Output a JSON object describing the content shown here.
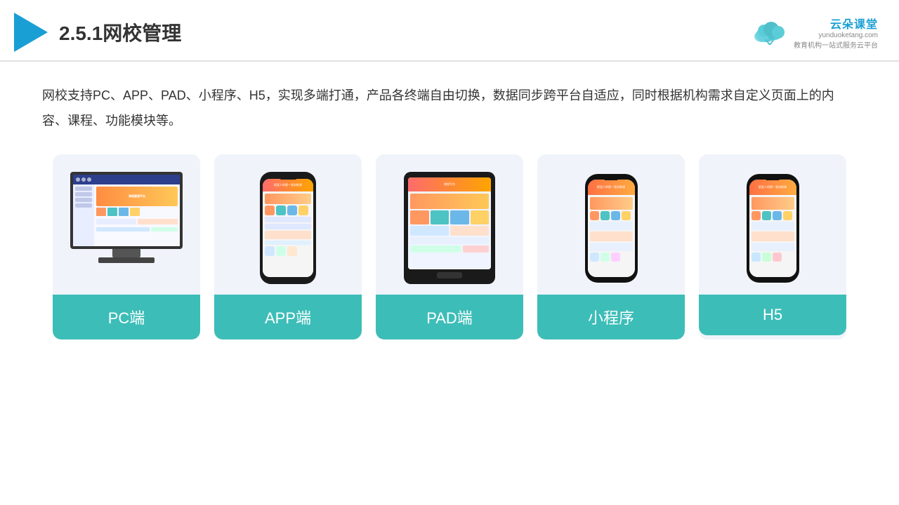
{
  "header": {
    "title_prefix": "2.5.1",
    "title_main": "网校管理",
    "brand_name": "云朵课堂",
    "brand_url": "yunduoketang.com",
    "brand_tagline": "教育机构一站式服务云平台"
  },
  "description": "网校支持PC、APP、PAD、小程序、H5，实现多端打通，产品各终端自由切换，数据同步跨平台自适应，同时根据机构需求自定义页面上的内容、课程、功能模块等。",
  "cards": [
    {
      "id": "pc",
      "label": "PC端"
    },
    {
      "id": "app",
      "label": "APP端"
    },
    {
      "id": "pad",
      "label": "PAD端"
    },
    {
      "id": "miniprogram",
      "label": "小程序"
    },
    {
      "id": "h5",
      "label": "H5"
    }
  ],
  "colors": {
    "accent": "#3dbdb8",
    "header_blue": "#1a9fd4",
    "triangle": "#1a9fd4",
    "divider": "#e0e0e0",
    "card_bg": "#f0f4fa",
    "text_main": "#333333",
    "brand_blue": "#1a9fd4"
  }
}
